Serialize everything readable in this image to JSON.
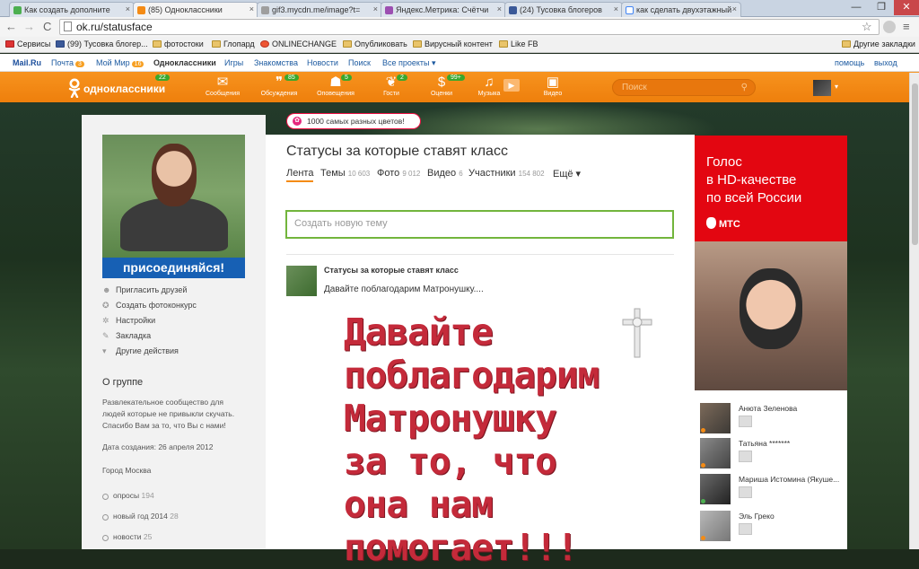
{
  "browser": {
    "tabs": [
      {
        "label": "Как создать дополните",
        "color": "#4caf50"
      },
      {
        "label": "(85) Одноклассники",
        "color": "#f48b15"
      },
      {
        "label": "gif3.mycdn.me/image?t=",
        "color": "#9e9e9e"
      },
      {
        "label": "Яндекс.Метрика: Счётчи",
        "color": "#9c4fb1"
      },
      {
        "label": "(24) Тусовка блогеров",
        "color": "#3b5998"
      },
      {
        "label": "как сделать двухэтажный",
        "color": "#ffffff"
      }
    ],
    "tab_close": "×",
    "url": "ok.ru/statusface",
    "back": "←",
    "forward": "→",
    "reload": "C",
    "star": "☆",
    "menu": "≡",
    "win_min": "—",
    "win_max": "❐",
    "win_close": "✕"
  },
  "bookmarks": {
    "items": [
      "Сервисы",
      "(99) Тусовка блогер...",
      "фотостоки",
      "Глопард",
      "ONLINECHANGE",
      "Опубликовать",
      "Вирусный контент",
      "Like FB"
    ],
    "other": "Другие закладки"
  },
  "mailru": {
    "items": [
      {
        "label": "Mail.Ru",
        "badge": ""
      },
      {
        "label": "Почта",
        "badge": "3"
      },
      {
        "label": "Мой Мир",
        "badge": "16"
      },
      {
        "label": "Одноклассники",
        "badge": ""
      },
      {
        "label": "Игры",
        "badge": ""
      },
      {
        "label": "Знакомства",
        "badge": ""
      },
      {
        "label": "Новости",
        "badge": ""
      },
      {
        "label": "Поиск",
        "badge": ""
      },
      {
        "label": "Все проекты ▾",
        "badge": ""
      }
    ],
    "help": "помощь",
    "exit": "выход"
  },
  "ok_header": {
    "logo_text": "одноклассники",
    "logo_count": "22",
    "nav": [
      {
        "label": "Сообщения",
        "icon": "envelope-icon",
        "glyph": "✉",
        "count": ""
      },
      {
        "label": "Обсуждения",
        "icon": "discussions-icon",
        "glyph": "❞",
        "count": "85"
      },
      {
        "label": "Оповещения",
        "icon": "bell-icon",
        "glyph": "☗",
        "count": "5"
      },
      {
        "label": "Гости",
        "icon": "footprints-icon",
        "glyph": "❦",
        "count": "2"
      },
      {
        "label": "Оценки",
        "icon": "rating-icon",
        "glyph": "$",
        "count": "99+"
      },
      {
        "label": "Музыка",
        "icon": "music-icon",
        "glyph": "♫",
        "count": ""
      },
      {
        "label": "",
        "icon": "play-icon",
        "glyph": "▶",
        "count": ""
      },
      {
        "label": "Видео",
        "icon": "video-icon",
        "glyph": "▣",
        "count": ""
      }
    ],
    "search_placeholder": "Поиск",
    "search_icon": "🔍"
  },
  "left": {
    "join_label": "присоединяйся!",
    "actions": [
      {
        "label": "Пригласить друзей",
        "icon": "people-icon",
        "glyph": "☻"
      },
      {
        "label": "Создать фотоконкурс",
        "icon": "medal-icon",
        "glyph": "✪"
      },
      {
        "label": "Настройки",
        "icon": "gear-icon",
        "glyph": "✲"
      },
      {
        "label": "Закладка",
        "icon": "bookmark-icon",
        "glyph": "✎"
      },
      {
        "label": "Другие действия",
        "icon": "chevron-down-icon",
        "glyph": "▾"
      }
    ],
    "group_heading": "О группе",
    "group_desc": "Развлекательное сообщество для людей которые не привыкли скучать. Спасибо Вам за то, что Вы с нами!",
    "created": "Дата создания: 26 апреля 2012",
    "city": "Город Москва",
    "tags": [
      {
        "label": "опросы",
        "count": "194"
      },
      {
        "label": "новый год 2014",
        "count": "28"
      },
      {
        "label": "новости",
        "count": "25"
      }
    ]
  },
  "main": {
    "promo": "1000 самых разных цветов!",
    "title": "Статусы за которые ставят класс",
    "tabs": [
      {
        "label": "Лента",
        "count": ""
      },
      {
        "label": "Темы",
        "count": "10 603"
      },
      {
        "label": "Фото",
        "count": "9 012"
      },
      {
        "label": "Видео",
        "count": "6"
      },
      {
        "label": "Участники",
        "count": "154 802"
      },
      {
        "label": "Ещё ▾",
        "count": ""
      }
    ],
    "new_topic_placeholder": "Создать новую тему",
    "post": {
      "author": "Статусы за которые ставят класс",
      "text": "Давайте поблагодарим Матронушку....",
      "image_lines": [
        "Давайте",
        "поблагодарим",
        "Матронушку",
        "за то, что",
        "она нам",
        "помогает!!!"
      ]
    }
  },
  "ad": {
    "lines": [
      "Голос",
      "в HD-качестве",
      "по всей России"
    ],
    "brand": "МТС"
  },
  "right_users": [
    {
      "name": "Анюта Зеленова"
    },
    {
      "name": "Татьяна *******"
    },
    {
      "name": "Мариша Истомина (Якуше..."
    },
    {
      "name": "Эль Греко"
    }
  ]
}
